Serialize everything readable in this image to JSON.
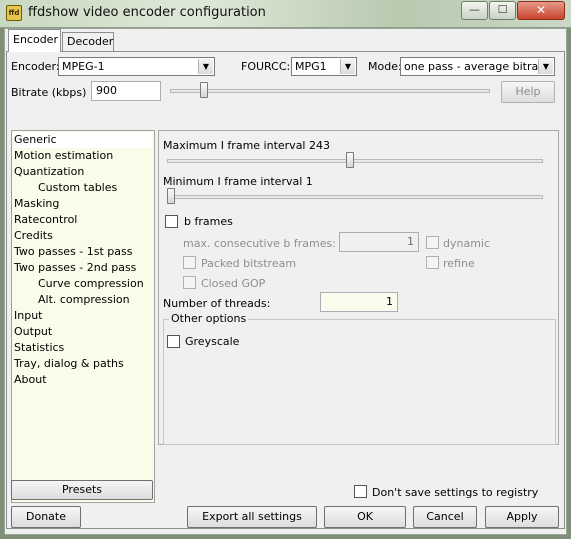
{
  "window": {
    "title": "ffdshow video encoder configuration",
    "icon_text": "ffd",
    "min_glyph": "—",
    "max_glyph": "☐",
    "close_glyph": "✕"
  },
  "tabs": [
    {
      "label": "Encoder",
      "active": true
    },
    {
      "label": "Decoder",
      "active": false
    }
  ],
  "top": {
    "encoder_label": "Encoder:",
    "encoder_value": "MPEG-1",
    "fourcc_label": "FOURCC:",
    "fourcc_value": "MPG1",
    "mode_label": "Mode:",
    "mode_value": "one pass - average bitrate",
    "bitrate_label": "Bitrate (kbps)",
    "bitrate_value": "900",
    "bitrate_slider_fraction": 0.1,
    "help_label": "Help",
    "dropdown_arrow": "▼"
  },
  "list": [
    {
      "label": "Generic",
      "selected": true,
      "sub": false
    },
    {
      "label": "Motion estimation",
      "sub": false
    },
    {
      "label": "Quantization",
      "sub": false
    },
    {
      "label": "Custom tables",
      "sub": true
    },
    {
      "label": "Masking",
      "sub": false
    },
    {
      "label": "Ratecontrol",
      "sub": false
    },
    {
      "label": "Credits",
      "sub": false
    },
    {
      "label": "Two passes - 1st pass",
      "sub": false
    },
    {
      "label": "Two passes - 2nd pass",
      "sub": false
    },
    {
      "label": "Curve compression",
      "sub": true
    },
    {
      "label": "Alt. compression",
      "sub": true
    },
    {
      "label": "Input",
      "sub": false
    },
    {
      "label": "Output",
      "sub": false
    },
    {
      "label": "Statistics",
      "sub": false
    },
    {
      "label": "Tray, dialog & paths",
      "sub": false
    },
    {
      "label": "About",
      "sub": false
    }
  ],
  "presets_label": "Presets",
  "generic": {
    "max_i_label": "Maximum I frame interval 243",
    "max_i_fraction": 0.49,
    "min_i_label": "Minimum I frame interval 1",
    "min_i_fraction": 0.0,
    "b_frames_label": "b frames",
    "b_frames_checked": false,
    "max_consecutive_label": "max. consecutive b frames:",
    "max_consecutive_value": "1",
    "dynamic_label": "dynamic",
    "packed_label": "Packed bitstream",
    "refine_label": "refine",
    "closed_gop_label": "Closed GOP",
    "threads_label": "Number of threads:",
    "threads_value": "1",
    "other_options_label": "Other options",
    "greyscale_label": "Greyscale",
    "greyscale_checked": false
  },
  "dont_save_label": "Don't save settings to registry",
  "dont_save_checked": false,
  "footer": {
    "donate": "Donate",
    "export": "Export all settings",
    "ok": "OK",
    "cancel": "Cancel",
    "apply": "Apply"
  }
}
